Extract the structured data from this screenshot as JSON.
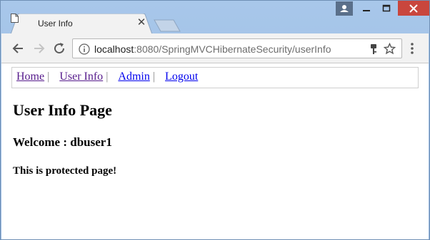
{
  "browser": {
    "tab": {
      "title": "User Info"
    },
    "address_bar": {
      "host": "localhost",
      "rest": ":8080/SpringMVCHibernateSecurity/userInfo"
    }
  },
  "page": {
    "nav": [
      {
        "label": "Home"
      },
      {
        "label": "User Info"
      },
      {
        "label": "Admin"
      },
      {
        "label": "Logout"
      }
    ],
    "separator": "|",
    "title": "User Info Page",
    "welcome": "Welcome : dbuser1",
    "message": "This is protected page!"
  }
}
